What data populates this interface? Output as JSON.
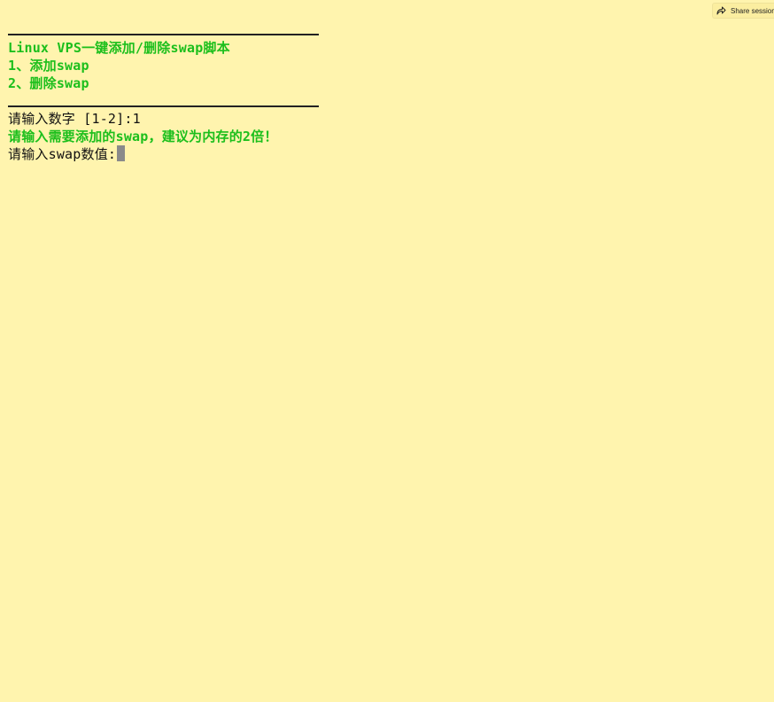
{
  "share_button": {
    "label": "Share session",
    "icon": "share-arrow-icon"
  },
  "terminal": {
    "lines": [
      {
        "kind": "rule"
      },
      {
        "kind": "text",
        "color": "#1cbf1c",
        "text": "Linux VPS一键添加/删除swap脚本"
      },
      {
        "kind": "text",
        "color": "#1cbf1c",
        "text": "1、添加swap"
      },
      {
        "kind": "text",
        "color": "#1cbf1c",
        "text": "2、删除swap"
      },
      {
        "kind": "rule"
      },
      {
        "kind": "text",
        "color": "#111111",
        "text": "请输入数字 [1-2]:1"
      },
      {
        "kind": "text",
        "color": "#1cbf1c",
        "text": "请输入需要添加的swap，建议为内存的2倍！"
      },
      {
        "kind": "prompt",
        "color": "#111111",
        "text": "请输入swap数值:"
      }
    ],
    "menu_title": "Linux VPS一键添加/删除swap脚本",
    "option_1": "1、添加swap",
    "option_2": "2、删除swap",
    "choice_prompt": "请输入数字 [1-2]:1",
    "hint": "请输入需要添加的swap，建议为内存的2倍！",
    "value_prompt": "请输入swap数值:",
    "cursor_color": "#8a8a8a",
    "background": "#fff4ae"
  }
}
